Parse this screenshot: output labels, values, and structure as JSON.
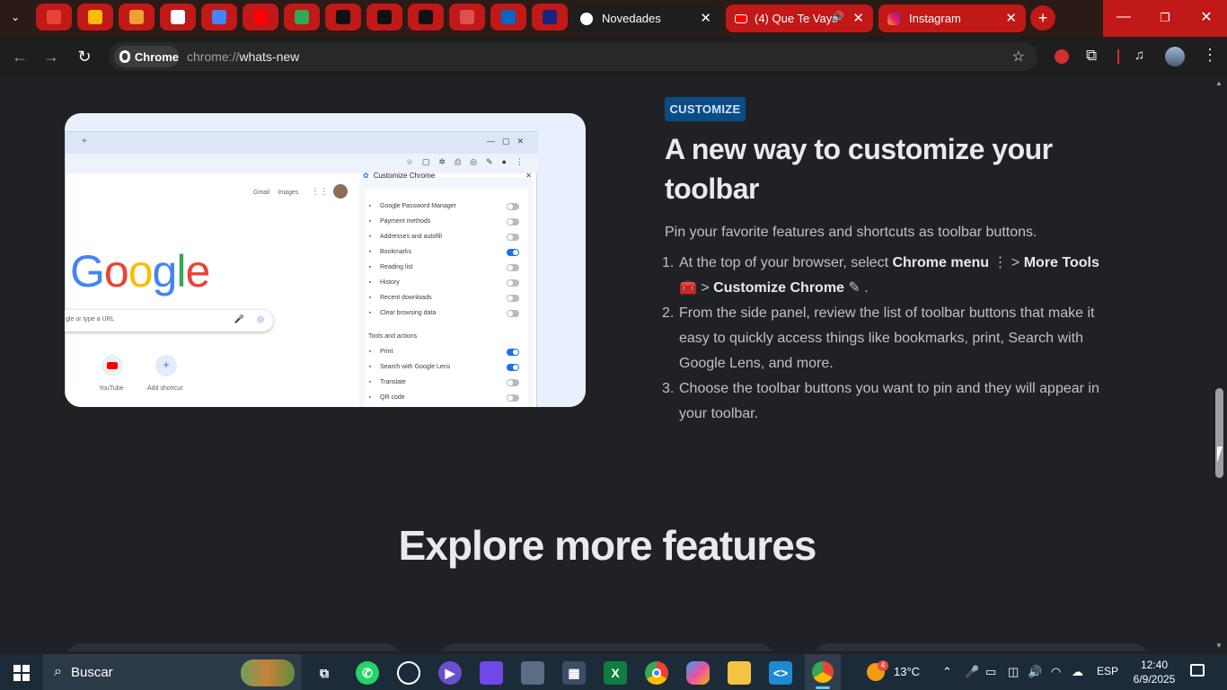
{
  "tabs": {
    "pinned": [
      {
        "name": "gmail-tab",
        "color": "#ea4335"
      },
      {
        "name": "drive-tab",
        "color": "#fbbc04"
      },
      {
        "name": "cloud-tab",
        "color": "#f0a030"
      },
      {
        "name": "google-tab",
        "color": "#ffffff"
      },
      {
        "name": "translate-tab",
        "color": "#4285f4"
      },
      {
        "name": "youtube-tab",
        "color": "#ff0000"
      },
      {
        "name": "green-app-tab",
        "color": "#34a853"
      },
      {
        "name": "asterisk-tab",
        "color": "#111111"
      },
      {
        "name": "github-tab",
        "color": "#111111"
      },
      {
        "name": "hex-tab",
        "color": "#111111"
      },
      {
        "name": "openai-tab",
        "color": "#e05050"
      },
      {
        "name": "linkedin-tab",
        "color": "#0a66c2"
      },
      {
        "name": "blue-app-tab",
        "color": "#1a237e"
      }
    ],
    "active": {
      "label": "Novedades"
    },
    "youtube": {
      "label": "(4) Que Te Vaya"
    },
    "instagram": {
      "label": "Instagram"
    },
    "new_tab": "+"
  },
  "omnibox": {
    "chip": "Chrome",
    "url_scheme": "chrome://",
    "url_path": "whats-new"
  },
  "feature": {
    "badge": "CUSTOMIZE",
    "title": "A new way to customize your toolbar",
    "description": "Pin your favorite features and shortcuts as toolbar buttons.",
    "steps": [
      {
        "num": "1.",
        "a": "At the top of your browser, select ",
        "b": "Chrome menu",
        "c": " ⋮ > ",
        "d": "More Tools",
        "e": "🧰 > ",
        "f": "Customize Chrome",
        "g": " ✎ ."
      },
      {
        "num": "2.",
        "text": "From the side panel, review the list of toolbar buttons that make it easy to quickly access things like bookmarks, print, Search with Google Lens, and more."
      },
      {
        "num": "3.",
        "text": "Choose the toolbar buttons you want to pin and they will appear in your toolbar."
      }
    ]
  },
  "illustration": {
    "links": [
      "Gmail",
      "Images"
    ],
    "logo": "Google",
    "search_placeholder": "gle or type a URL",
    "shortcuts": [
      "YouTube",
      "Add shortcut"
    ],
    "panel_title": "Customize Chrome",
    "items": [
      {
        "label": "Google Password Manager",
        "on": false
      },
      {
        "label": "Payment methods",
        "on": false
      },
      {
        "label": "Addresses and autofill",
        "on": false
      },
      {
        "label": "Bookmarks",
        "on": true
      },
      {
        "label": "Reading list",
        "on": false
      },
      {
        "label": "History",
        "on": false
      },
      {
        "label": "Recent downloads",
        "on": false
      },
      {
        "label": "Clear browsing data",
        "on": false
      }
    ],
    "section2": "Tools and actions",
    "items2": [
      {
        "label": "Print",
        "on": true
      },
      {
        "label": "Search with Google Lens",
        "on": true
      },
      {
        "label": "Translate",
        "on": false
      },
      {
        "label": "QR code",
        "on": false
      }
    ]
  },
  "explore": "Explore more features",
  "taskbar": {
    "search": "Buscar",
    "notif_count": "4",
    "temp": "13°C",
    "lang": "ESP",
    "time": "12:40",
    "date": "6/9/2025"
  }
}
